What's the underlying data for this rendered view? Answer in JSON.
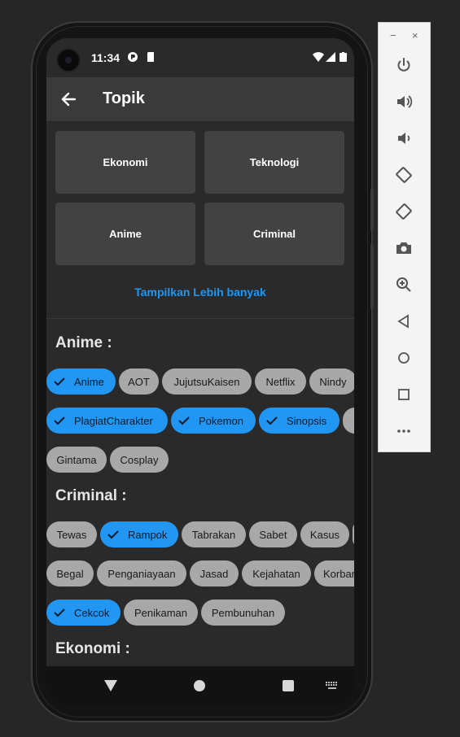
{
  "status_bar": {
    "time": "11:34"
  },
  "app_bar": {
    "title": "Topik",
    "back_icon": "arrow-left-icon"
  },
  "topic_tiles": [
    "Ekonomi",
    "Teknologi",
    "Anime",
    "Criminal"
  ],
  "show_more_label": "Tampilkan Lebih banyak",
  "colors": {
    "accent": "#2196f3",
    "chip": "#a8a8a8",
    "tile": "#424242",
    "background": "#2a2a2a"
  },
  "sections": [
    {
      "title": "Anime :",
      "chips": [
        [
          {
            "label": "Anime",
            "selected": true
          },
          {
            "label": "AOT",
            "selected": false
          },
          {
            "label": "JujutsuKaisen",
            "selected": false
          },
          {
            "label": "Netflix",
            "selected": false
          },
          {
            "label": "Nindy",
            "selected": false
          }
        ],
        [
          {
            "label": "PlagiatCharakter",
            "selected": true
          },
          {
            "label": "Pokemon",
            "selected": true
          },
          {
            "label": "Sinopsis",
            "selected": true
          }
        ],
        [
          {
            "label": "Gintama",
            "selected": false
          },
          {
            "label": "Cosplay",
            "selected": false
          }
        ]
      ]
    },
    {
      "title": "Criminal :",
      "chips": [
        [
          {
            "label": "Tewas",
            "selected": false
          },
          {
            "label": "Rampok",
            "selected": true
          },
          {
            "label": "Tabrakan",
            "selected": false
          },
          {
            "label": "Sabet",
            "selected": false
          },
          {
            "label": "Kasus",
            "selected": false
          }
        ],
        [
          {
            "label": "Begal",
            "selected": false
          },
          {
            "label": "Penganiayaan",
            "selected": false
          },
          {
            "label": "Jasad",
            "selected": false
          },
          {
            "label": "Kejahatan",
            "selected": false
          },
          {
            "label": "Korban",
            "selected": false
          }
        ],
        [
          {
            "label": "Cekcok",
            "selected": true
          },
          {
            "label": "Penikaman",
            "selected": false
          },
          {
            "label": "Pembunuhan",
            "selected": false
          }
        ]
      ]
    },
    {
      "title": "Ekonomi :",
      "chips": []
    }
  ],
  "nav_bar": {
    "icons": [
      "back-triangle-icon",
      "home-circle-icon",
      "recents-square-icon",
      "keyboard-icon"
    ]
  },
  "emulator_toolbar": {
    "window_controls": [
      "−",
      "×"
    ],
    "icons": [
      "power-icon",
      "volume-up-icon",
      "volume-down-icon",
      "rotate-left-icon",
      "rotate-right-icon",
      "camera-icon",
      "zoom-icon",
      "back-icon",
      "home-icon",
      "overview-icon",
      "more-icon"
    ]
  }
}
